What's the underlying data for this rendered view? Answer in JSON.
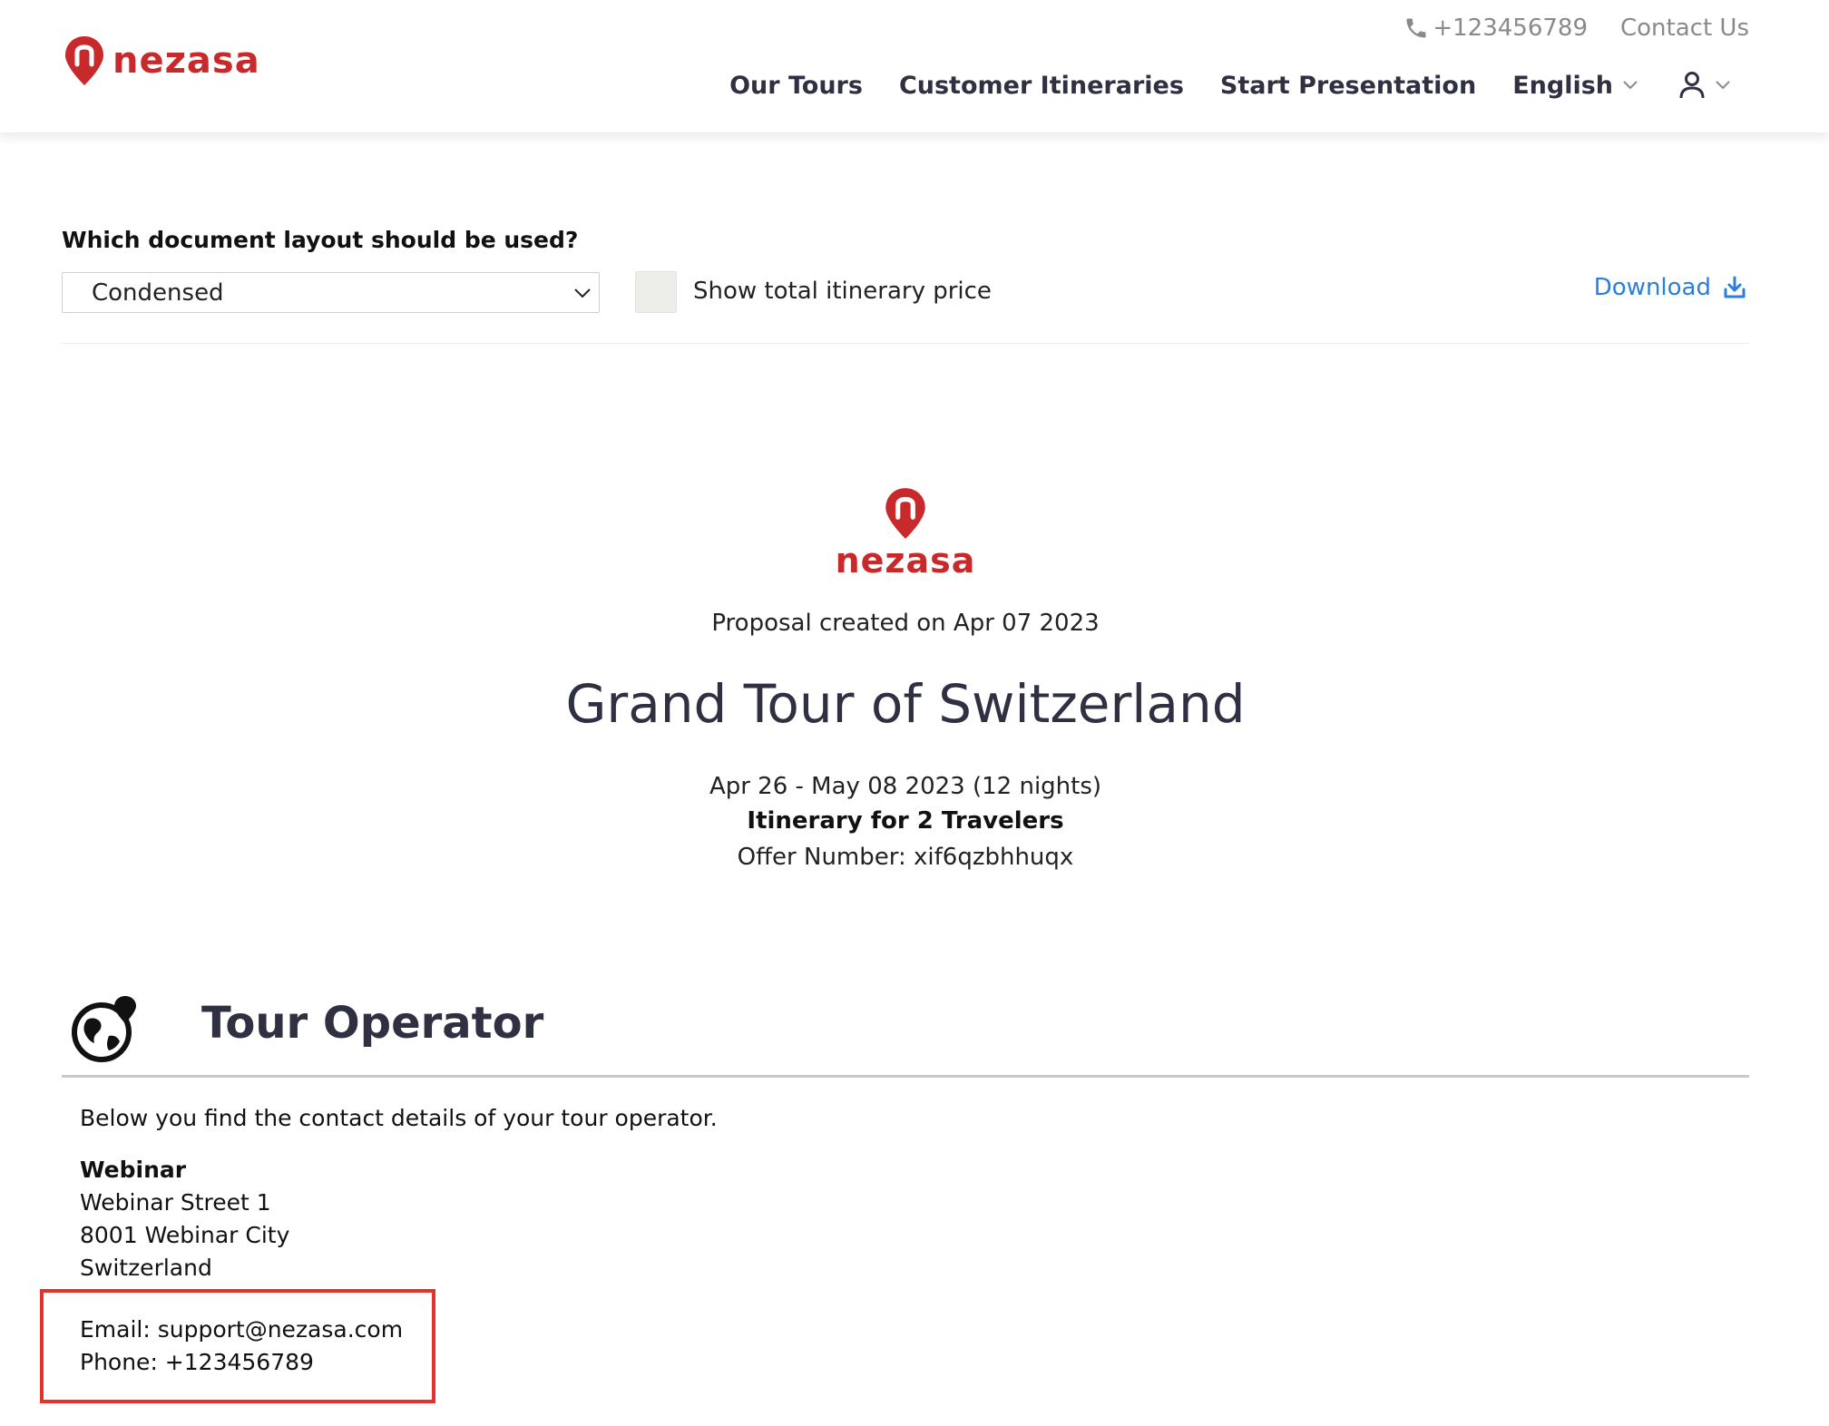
{
  "header": {
    "brand": "nezasa",
    "phone": "+123456789",
    "contact_link": "Contact Us",
    "nav": {
      "our_tours": "Our Tours",
      "customer_itineraries": "Customer Itineraries",
      "start_presentation": "Start Presentation",
      "language": "English"
    }
  },
  "options": {
    "question": "Which document layout should be used?",
    "layout_selected": "Condensed",
    "show_price_label": "Show total itinerary price",
    "show_price_checked": false,
    "download_label": "Download"
  },
  "proposal": {
    "brand": "nezasa",
    "created": "Proposal created on Apr 07 2023",
    "title": "Grand Tour of Switzerland",
    "dates": "Apr 26 - May 08 2023 (12 nights)",
    "travelers": "Itinerary for 2 Travelers",
    "offer_number": "Offer Number: xif6qzbhhuqx"
  },
  "tour_operator": {
    "heading": "Tour Operator",
    "intro": "Below you find the contact details of your tour operator.",
    "name": "Webinar",
    "street": "Webinar Street 1",
    "city": "8001 Webinar City",
    "country": "Switzerland",
    "email": "Email: support@nezasa.com",
    "phone": "Phone: +123456789"
  },
  "colors": {
    "brand_red": "#c8292b",
    "link_blue": "#2c7fd9",
    "highlight_red": "#e0342c",
    "heading_dark": "#2f3142"
  }
}
